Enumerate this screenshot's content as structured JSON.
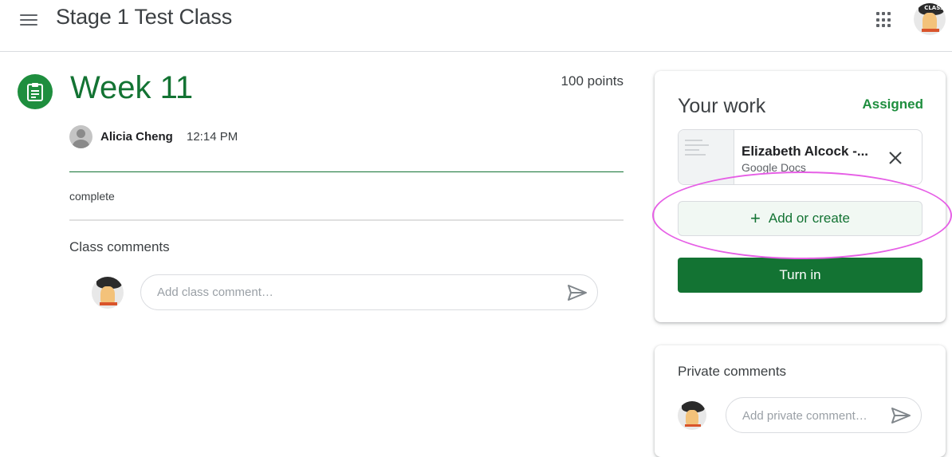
{
  "header": {
    "class_title": "Stage 1 Test Class",
    "menu_icon": "hamburger-menu-icon",
    "apps_icon": "apps-grid-icon",
    "avatar_text": "CLASS"
  },
  "assignment": {
    "icon": "assignment-icon",
    "title": "Week 11",
    "points": "100 points",
    "author": "Alicia Cheng",
    "time": "12:14 PM",
    "description": "complete"
  },
  "class_comments": {
    "heading": "Class comments",
    "placeholder": "Add class comment…"
  },
  "your_work": {
    "title": "Your work",
    "status": "Assigned",
    "attachment": {
      "name": "Elizabeth Alcock -...",
      "type": "Google Docs"
    },
    "add_label": "Add or create",
    "turn_in_label": "Turn in"
  },
  "private_comments": {
    "heading": "Private comments",
    "placeholder": "Add private comment…"
  },
  "colors": {
    "accent_green": "#137333",
    "status_green": "#1e8e3e",
    "highlight": "#e65fe6"
  }
}
